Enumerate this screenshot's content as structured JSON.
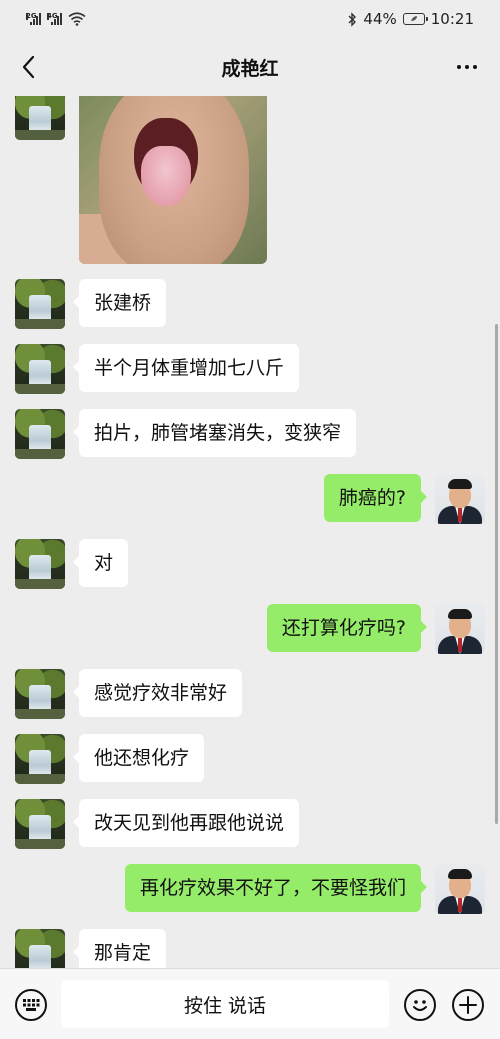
{
  "status_bar": {
    "signal1_tag": "2G",
    "signal2_tag": "4G",
    "battery": "44%",
    "time": "10:21"
  },
  "header": {
    "title": "成艳红"
  },
  "messages": [
    {
      "side": "in",
      "type": "image"
    },
    {
      "side": "in",
      "type": "text",
      "text": "张建桥"
    },
    {
      "side": "in",
      "type": "text",
      "text": "半个月体重增加七八斤"
    },
    {
      "side": "in",
      "type": "text",
      "text": "拍片，肺管堵塞消失，变狭窄"
    },
    {
      "side": "out",
      "type": "text",
      "text": "肺癌的?"
    },
    {
      "side": "in",
      "type": "text",
      "text": "对"
    },
    {
      "side": "out",
      "type": "text",
      "text": "还打算化疗吗?"
    },
    {
      "side": "in",
      "type": "text",
      "text": "感觉疗效非常好"
    },
    {
      "side": "in",
      "type": "text",
      "text": "他还想化疗"
    },
    {
      "side": "in",
      "type": "text",
      "text": "改天见到他再跟他说说"
    },
    {
      "side": "out",
      "type": "text",
      "text": "再化疗效果不好了，不要怪我们"
    },
    {
      "side": "in",
      "type": "text",
      "text": "那肯定"
    }
  ],
  "input_bar": {
    "voice_label": "按住 说话"
  },
  "icons": {
    "keyboard": "keyboard-icon",
    "emoji": "emoji-icon",
    "plus": "plus-icon",
    "back": "back-arrow-icon",
    "more": "more-icon"
  },
  "colors": {
    "outgoing_bubble": "#95ec69",
    "incoming_bubble": "#ffffff",
    "background": "#ededed"
  }
}
